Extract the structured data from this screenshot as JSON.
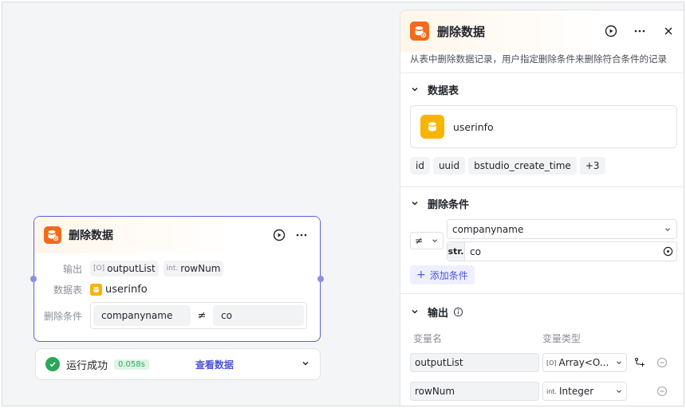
{
  "node": {
    "title": "删除数据",
    "output_label": "输出",
    "outputs": [
      {
        "type_prefix": "[O]",
        "name": "outputList"
      },
      {
        "type_prefix": "int.",
        "name": "rowNum"
      }
    ],
    "table_label": "数据表",
    "table_name": "userinfo",
    "condition_label": "删除条件",
    "condition": {
      "field": "companyname",
      "operator": "≠",
      "value": "co"
    }
  },
  "run_status": {
    "text": "运行成功",
    "duration": "0.058s",
    "view_data": "查看数据"
  },
  "panel": {
    "title": "删除数据",
    "description": "从表中删除数据记录，用户指定删除条件来删除符合条件的记录",
    "table_section": {
      "title": "数据表",
      "table_name": "userinfo",
      "columns": [
        "id",
        "uuid",
        "bstudio_create_time",
        "+3"
      ]
    },
    "condition_section": {
      "title": "删除条件",
      "operator": "≠",
      "field": "companyname",
      "value_type": "str.",
      "value": "co",
      "add_label": "添加条件"
    },
    "output_section": {
      "title": "输出",
      "col_name": "变量名",
      "col_type": "变量类型",
      "rows": [
        {
          "name": "outputList",
          "type_prefix": "[O]",
          "type": "Array<O..."
        },
        {
          "name": "rowNum",
          "type_prefix": "int.",
          "type": "Integer"
        }
      ]
    }
  },
  "colors": {
    "accent": "#4e54d9",
    "node_icon": "#f26a1b",
    "table_icon": "#f7b500",
    "success": "#2aa85a"
  }
}
